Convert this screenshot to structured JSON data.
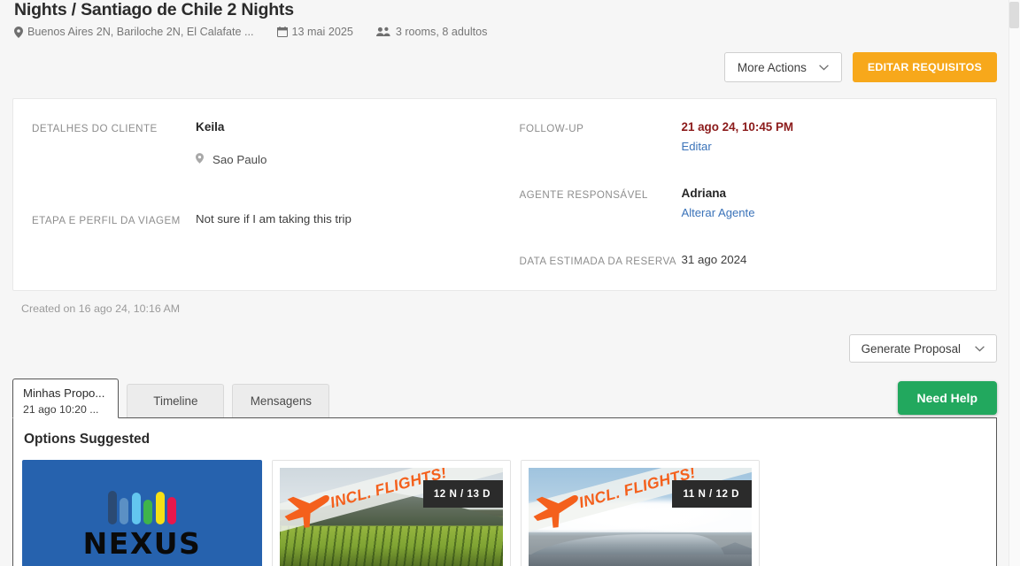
{
  "header": {
    "title": "Nights / Santiago de Chile 2 Nights",
    "destinations": "Buenos Aires 2N, Bariloche 2N, El Calafate ...",
    "date": "13 mai 2025",
    "pax": "3 rooms, 8 adultos"
  },
  "actions": {
    "more_actions": "More Actions",
    "edit_requirements": "EDITAR REQUISITOS"
  },
  "detail": {
    "client_label": "DETALHES DO CLIENTE",
    "client_name": "Keila",
    "client_city": "Sao Paulo",
    "stage_label": "ETAPA E PERFIL DA VIAGEM",
    "stage_value": "Not sure if I am taking this trip",
    "followup_label": "FOLLOW-UP",
    "followup_value": "21 ago 24, 10:45 PM",
    "followup_link": "Editar",
    "agent_label": "AGENTE RESPONSÁVEL",
    "agent_name": "Adriana",
    "agent_link": "Alterar Agente",
    "booking_date_label": "DATA ESTIMADA DA RESERVA",
    "booking_date_value": "31 ago 2024"
  },
  "created_on": "Created on 16 ago 24, 10:16 AM",
  "generate_proposal": "Generate Proposal",
  "tabs": {
    "active": {
      "label": "Minhas Propo...",
      "sub": "21 ago 10:20 ..."
    },
    "others": [
      {
        "label": "Timeline"
      },
      {
        "label": "Mensagens"
      }
    ]
  },
  "need_help": "Need Help",
  "panel": {
    "title": "Options Suggested",
    "cards": [
      {
        "kind": "logo",
        "brand": "NEXUS"
      },
      {
        "kind": "photo",
        "scene": "vineyard",
        "ribbon": "INCL. FLIGHTS!",
        "badge": "12 N / 13 D"
      },
      {
        "kind": "photo",
        "scene": "airport",
        "ribbon": "INCL. FLIGHTS!",
        "badge": "11 N / 12 D"
      }
    ]
  },
  "colors": {
    "primary_orange": "#f7a81b",
    "accent_green": "#22a85e",
    "link_blue": "#3b73b9",
    "danger_red": "#8b1a1a",
    "nexus_blue": "#2662ae",
    "ribbon_orange": "#f4601c",
    "nexus_bars": [
      "#2b4a73",
      "#5b90c4",
      "#63c6ef",
      "#3fb44a",
      "#f5e016",
      "#e8174c"
    ]
  }
}
